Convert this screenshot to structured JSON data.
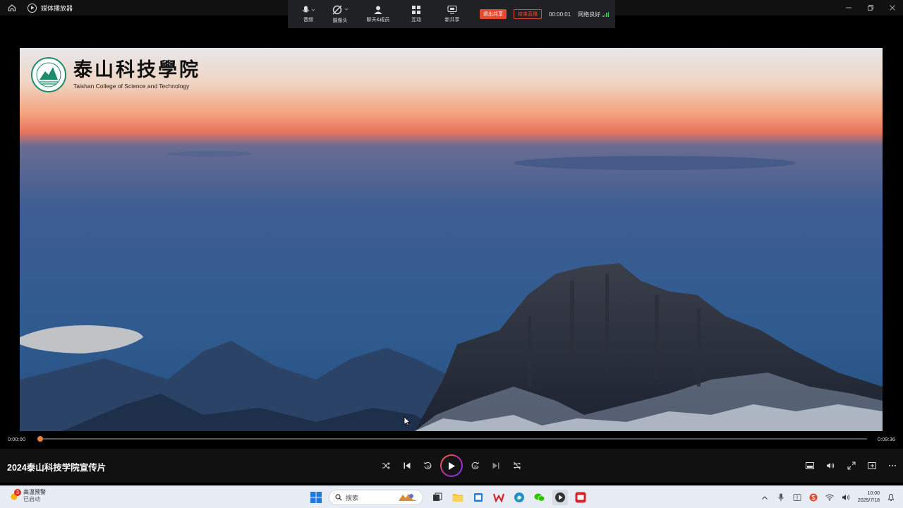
{
  "window": {
    "title": "媒体播放器"
  },
  "share_bar": {
    "items": [
      {
        "label": "音频",
        "icon": "microphone-icon"
      },
      {
        "label": "摄像头",
        "icon": "camera-off-icon"
      },
      {
        "label": "聊天&成员",
        "icon": "person-icon"
      },
      {
        "label": "互动",
        "icon": "grid-icon"
      },
      {
        "label": "新共享",
        "icon": "share-screen-icon"
      }
    ],
    "exit_share": "退出共享",
    "end_live": "结束直播",
    "timer": "00:00:01",
    "network": "网络良好",
    "colors": {
      "accent": "#e34a2f",
      "signal": "#34c759"
    }
  },
  "video": {
    "logo_cn": "泰山科技學院",
    "logo_en": "Taishan College of Science and Technology"
  },
  "player": {
    "current_time": "0:00:00",
    "total_time": "0:09:36",
    "progress": 0.0,
    "title": "2024泰山科技学院宣传片",
    "accent": "#e8813a"
  },
  "taskbar": {
    "weather_badge": "3",
    "weather_title": "高温预警",
    "weather_sub": "已启动",
    "search_placeholder": "搜索",
    "clock_time": "10:00",
    "clock_date": "2025/7/18"
  }
}
